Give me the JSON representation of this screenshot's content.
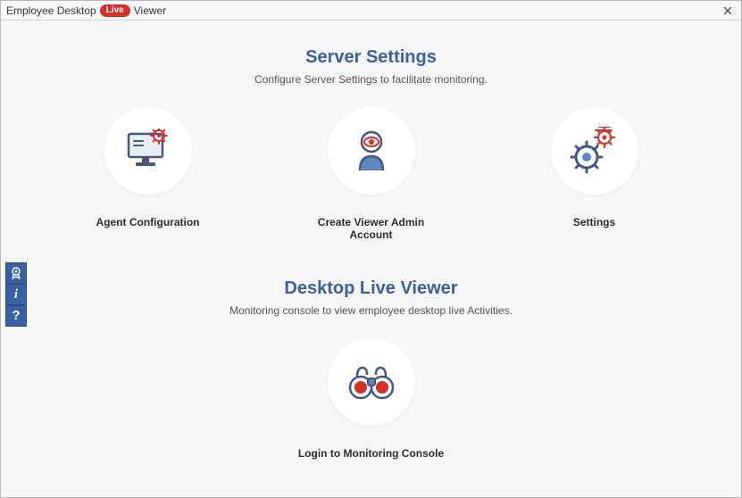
{
  "window": {
    "title_part1": "Employee Desktop",
    "title_badge": "Live",
    "title_part2": "Viewer"
  },
  "sections": {
    "server": {
      "title": "Server Settings",
      "subtitle": "Configure Server Settings to facilitate monitoring.",
      "cards": {
        "agent": "Agent Configuration",
        "admin": "Create Viewer Admin Account",
        "settings": "Settings"
      }
    },
    "viewer": {
      "title": "Desktop Live Viewer",
      "subtitle": "Monitoring console to view employee desktop live Activities.",
      "cards": {
        "login": "Login to Monitoring Console"
      }
    }
  },
  "colors": {
    "accent": "#3c5fa3",
    "danger": "#d6302a",
    "icon_blue": "#46597c",
    "icon_fill": "#6185c0"
  }
}
